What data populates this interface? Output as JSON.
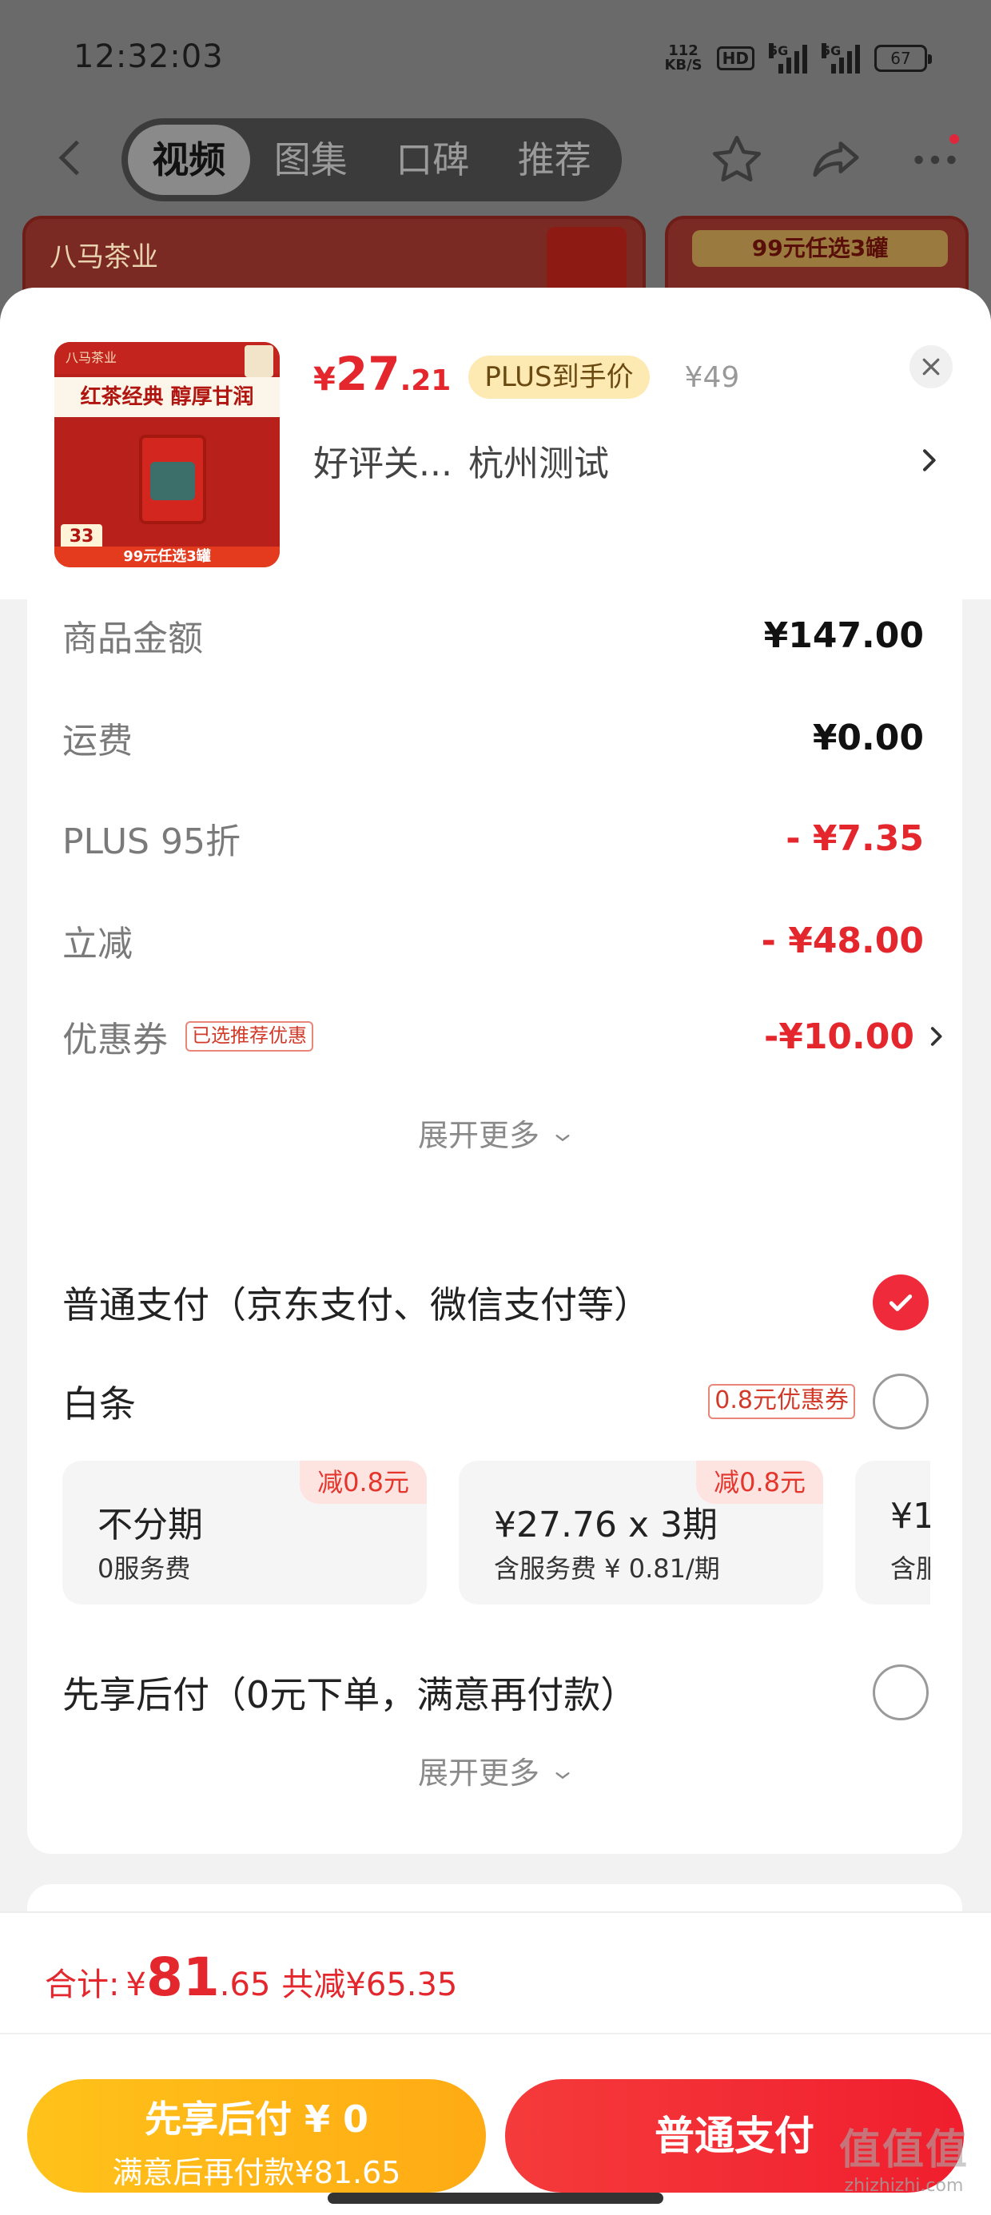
{
  "status_bar": {
    "time": "12:32:03",
    "net_speed_value": "112",
    "net_speed_unit": "KB/S",
    "hd_label": "HD",
    "sim1_label": "5G",
    "sim2_label": "5G",
    "battery": "67"
  },
  "nav": {
    "tabs": [
      {
        "label": "视频"
      },
      {
        "label": "图集"
      },
      {
        "label": "口碑"
      },
      {
        "label": "推荐"
      }
    ],
    "active_tab": "视频"
  },
  "banner": {
    "brand": "八马茶业",
    "promo": "99元任选3罐"
  },
  "product": {
    "thumb_logo": "八马茶业",
    "thumb_headline": "红茶经典 醇厚甘润",
    "thumb_number": "33",
    "thumb_promo": "99元任选3罐",
    "price_currency": "¥",
    "price_int": "27",
    "price_dec": ".21",
    "plus_tag": "PLUS到手价",
    "original_price": "¥49",
    "spec": "好评关...",
    "address": "杭州测试"
  },
  "amounts": {
    "rows": [
      {
        "label": "商品金额",
        "value": "¥147.00"
      },
      {
        "label": "运费",
        "value": "¥0.00"
      },
      {
        "label": "PLUS 95折",
        "value": "- ¥7.35"
      },
      {
        "label": "立减",
        "value": "- ¥48.00"
      }
    ],
    "coupon": {
      "label": "优惠券",
      "tag": "已选推荐优惠",
      "value": "-¥10.00"
    },
    "expand_label": "展开更多"
  },
  "payment": {
    "normal": {
      "label": "普通支付（京东支付、微信支付等）",
      "checked": true
    },
    "baitiao": {
      "label": "白条",
      "coupon": "0.8元优惠券",
      "checked": false
    },
    "installments": [
      {
        "main": "不分期",
        "sub": "0服务费",
        "badge": "减0.8元"
      },
      {
        "main": "¥27.76 x 3期",
        "sub": "含服务费 ¥ 0.81/期",
        "badge": "减0.8元"
      },
      {
        "main": "¥1",
        "sub": "含服",
        "badge": ""
      }
    ],
    "pay_later": {
      "label": "先享后付（0元下单，满意再付款）",
      "checked": false
    },
    "expand_label": "展开更多"
  },
  "footer": {
    "total_label": "合计:",
    "total_currency": "¥",
    "total_int": "81",
    "total_dec": ".65",
    "saved": "共减¥65.35",
    "btn_later_line1": "先享后付 ¥ 0",
    "btn_later_line2": "满意后再付款¥81.65",
    "btn_normal": "普通支付"
  },
  "watermark": {
    "logo": "值值值",
    "url": "zhizhizhi.com"
  },
  "colors": {
    "accent_red": "#e4262d",
    "plus_gold": "#fde9b2",
    "btn_yellow": "#ffb814",
    "btn_red": "#f0263a"
  }
}
